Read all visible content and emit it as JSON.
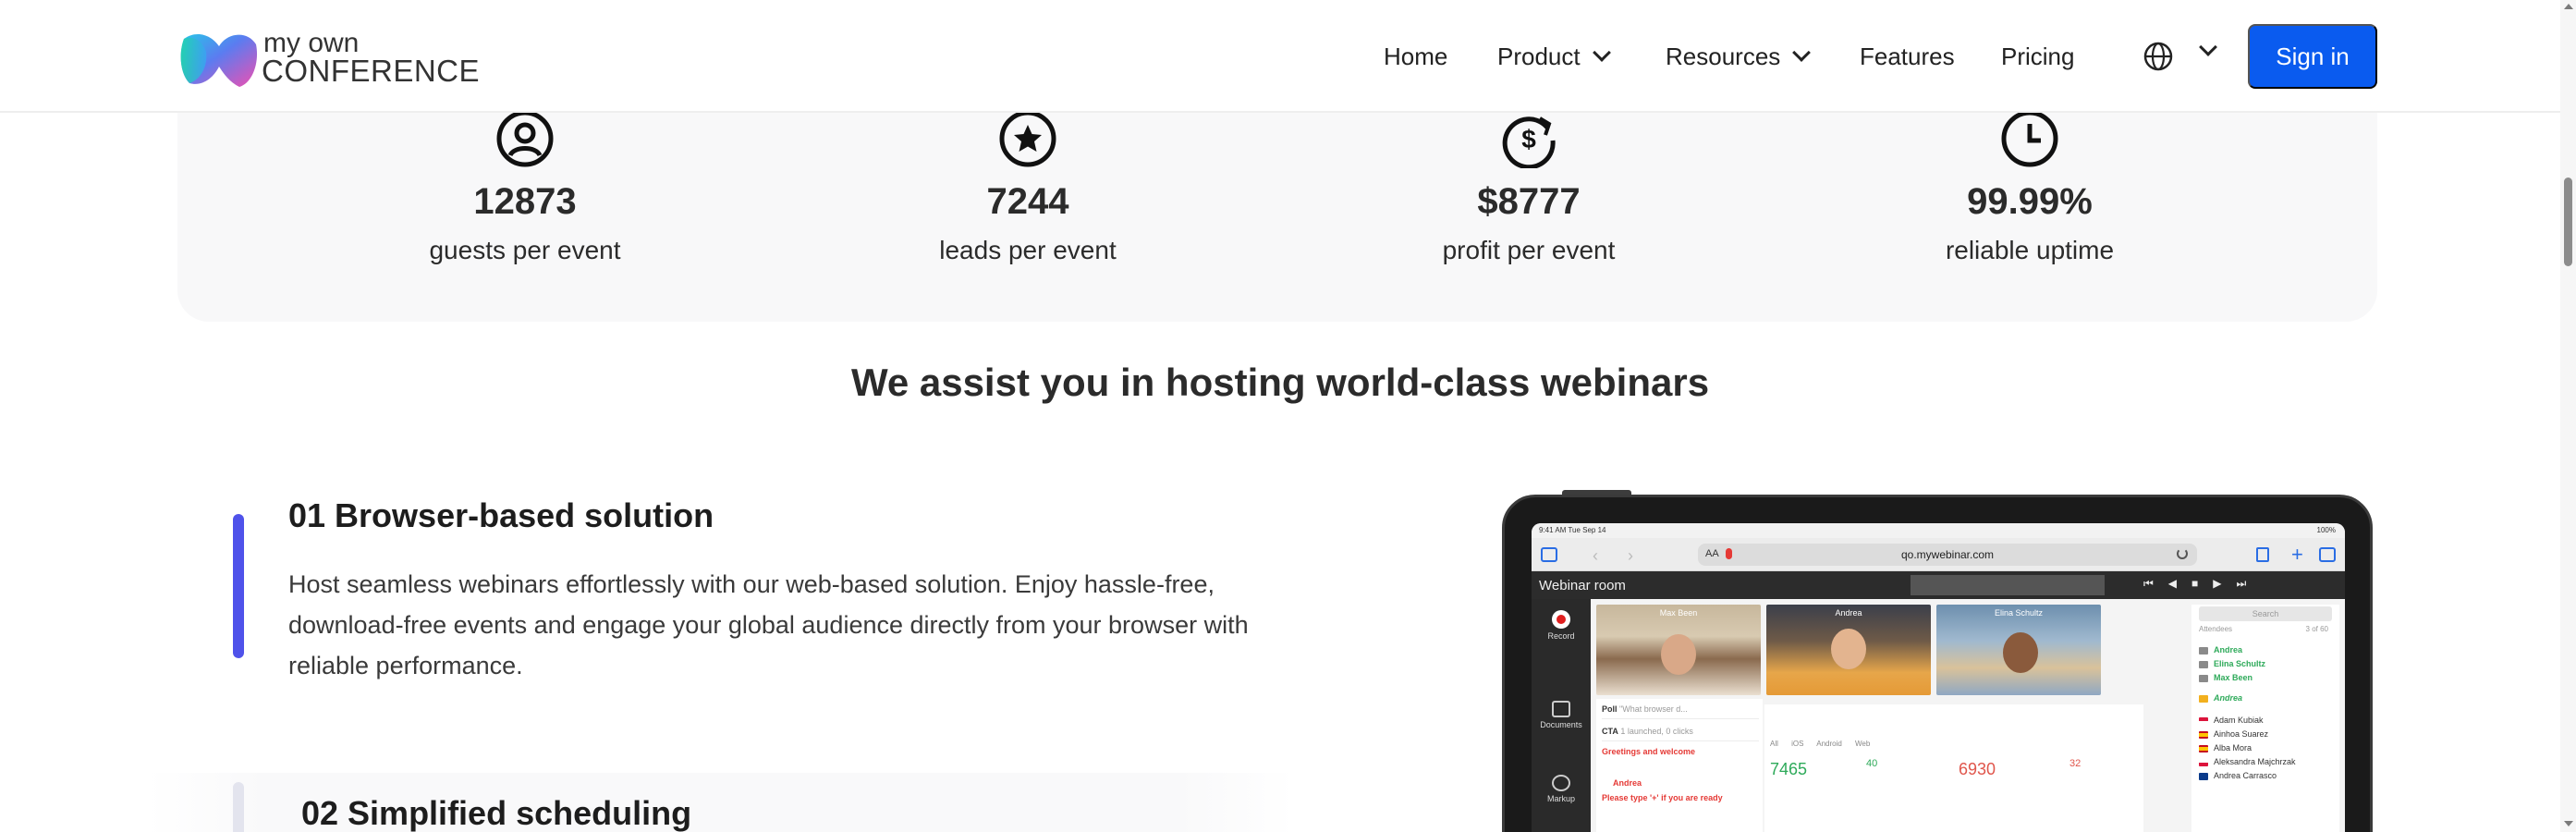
{
  "header": {
    "logo": {
      "line1": "my own",
      "line2": "CONFERENCE"
    },
    "nav": [
      {
        "label": "Home",
        "has_dropdown": false
      },
      {
        "label": "Product",
        "has_dropdown": true
      },
      {
        "label": "Resources",
        "has_dropdown": true
      },
      {
        "label": "Features",
        "has_dropdown": false
      },
      {
        "label": "Pricing",
        "has_dropdown": false
      }
    ],
    "language_icon": "globe-icon",
    "signin_label": "Sign in"
  },
  "stats": [
    {
      "icon": "user-circle-icon",
      "value": "12873",
      "label": "guests per event"
    },
    {
      "icon": "star-circle-icon",
      "value": "7244",
      "label": "leads per event"
    },
    {
      "icon": "dollar-refresh-icon",
      "value": "$8777",
      "label": "profit per event"
    },
    {
      "icon": "clock-icon",
      "value": "99.99%",
      "label": "reliable uptime"
    }
  ],
  "section": {
    "title": "We assist you in hosting world-class webinars",
    "features": [
      {
        "title": "01 Browser-based solution",
        "description": "Host seamless webinars effortlessly with our web-based solution. Enjoy hassle-free, download-free events and engage your global audience directly from your browser with reliable performance."
      },
      {
        "title": "02 Simplified scheduling"
      }
    ]
  },
  "mockup": {
    "status_time": "9:41 AM  Tue Sep 14",
    "status_right": "100%",
    "url": "qo.mywebinar.com",
    "url_aa": "AA",
    "room_title": "Webinar room",
    "sidebar": [
      "Record",
      "Documents",
      "Markup"
    ],
    "videos": [
      "Max Been",
      "Andrea",
      "Elina Schultz"
    ],
    "poll": {
      "label": "Poll",
      "question": "\"What browser d...",
      "cta_label": "CTA",
      "cta_value": "1 launched, 0 clicks"
    },
    "chat": {
      "title": "Greetings and welcome",
      "name": "Andrea",
      "message": "Please type '+' if you are ready"
    },
    "analytics": {
      "tabs": "All iOS Android Web",
      "num1": "7465",
      "small1": "40",
      "num2": "6930",
      "small2": "32"
    },
    "attendees": {
      "search_placeholder": "Search",
      "heading": "Attendees",
      "count": "3 of 60",
      "hosts": [
        "Andrea",
        "Elina Schultz",
        "Max Been"
      ],
      "presenter": "Andrea",
      "list": [
        "Adam Kubiak",
        "Ainhoa Suarez",
        "Alba Mora",
        "Aleksandra Majchrzak",
        "Andrea Carrasco"
      ]
    }
  },
  "colors": {
    "primary": "#0a5bef",
    "accent_bar": "#4f52ea",
    "text": "#2b2b2b",
    "stats_bg": "#f8f8f9"
  }
}
